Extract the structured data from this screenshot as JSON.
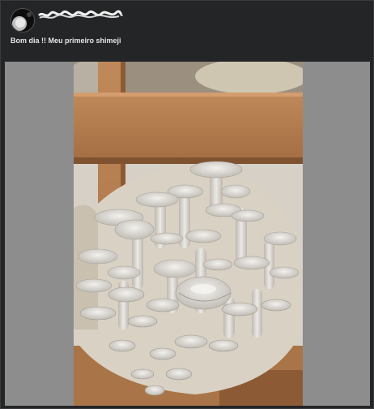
{
  "post": {
    "author": {
      "name_redacted": true,
      "avatar_icon": "profile-avatar-icon"
    },
    "caption": "Bom dia !! Meu primeiro shimeji",
    "image": {
      "subject": "mushroom-photo"
    }
  },
  "colors": {
    "panel_bg": "#242526",
    "text_primary": "#e4e6eb",
    "media_letterbox": "#8d8d8d"
  }
}
